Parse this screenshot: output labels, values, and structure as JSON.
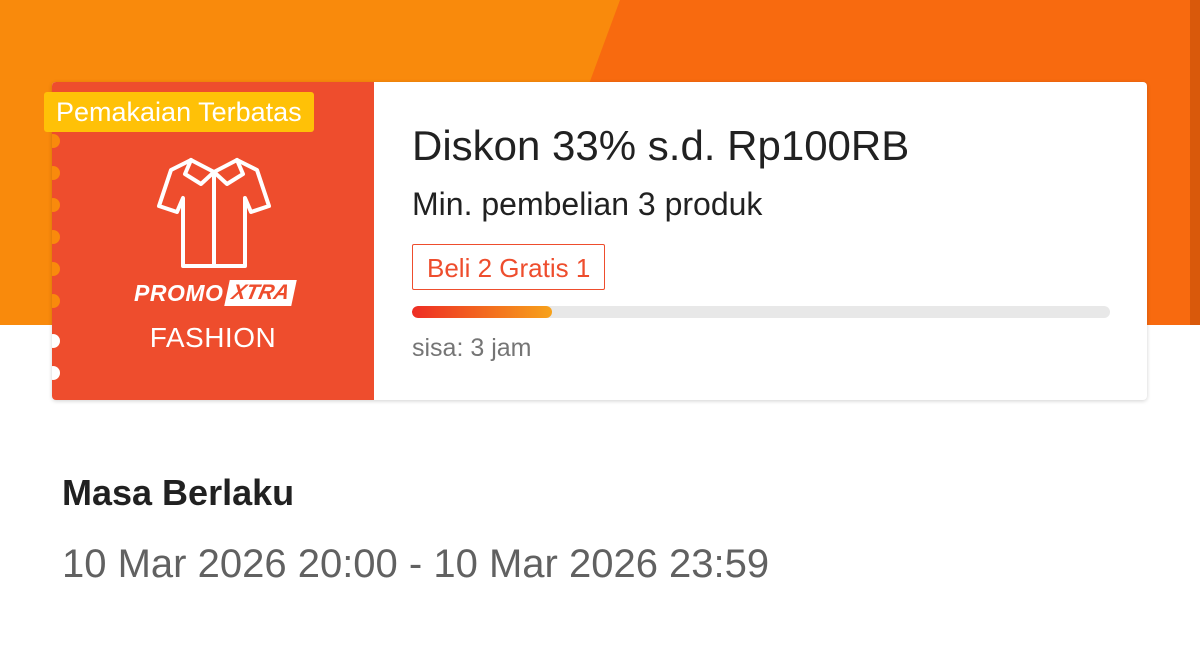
{
  "voucher": {
    "badge": "Pemakaian Terbatas",
    "icon": "shirt-icon",
    "logo": {
      "word1": "PROMO",
      "word2": "XTRA"
    },
    "category": "FASHION",
    "title": "Diskon 33% s.d. Rp100RB",
    "min_purchase": "Min. pembelian 3 produk",
    "tag": "Beli 2 Gratis 1",
    "progress_fraction": 0.2,
    "remaining": "sisa: 3 jam"
  },
  "validity": {
    "label": "Masa Berlaku",
    "period": "10 Mar 2026 20:00 - 10 Mar 2026 23:59"
  },
  "colors": {
    "brand": "#ee4d2d",
    "header_light": "#f98a0c",
    "header_dark": "#f86a0f",
    "badge": "#ffc107"
  }
}
